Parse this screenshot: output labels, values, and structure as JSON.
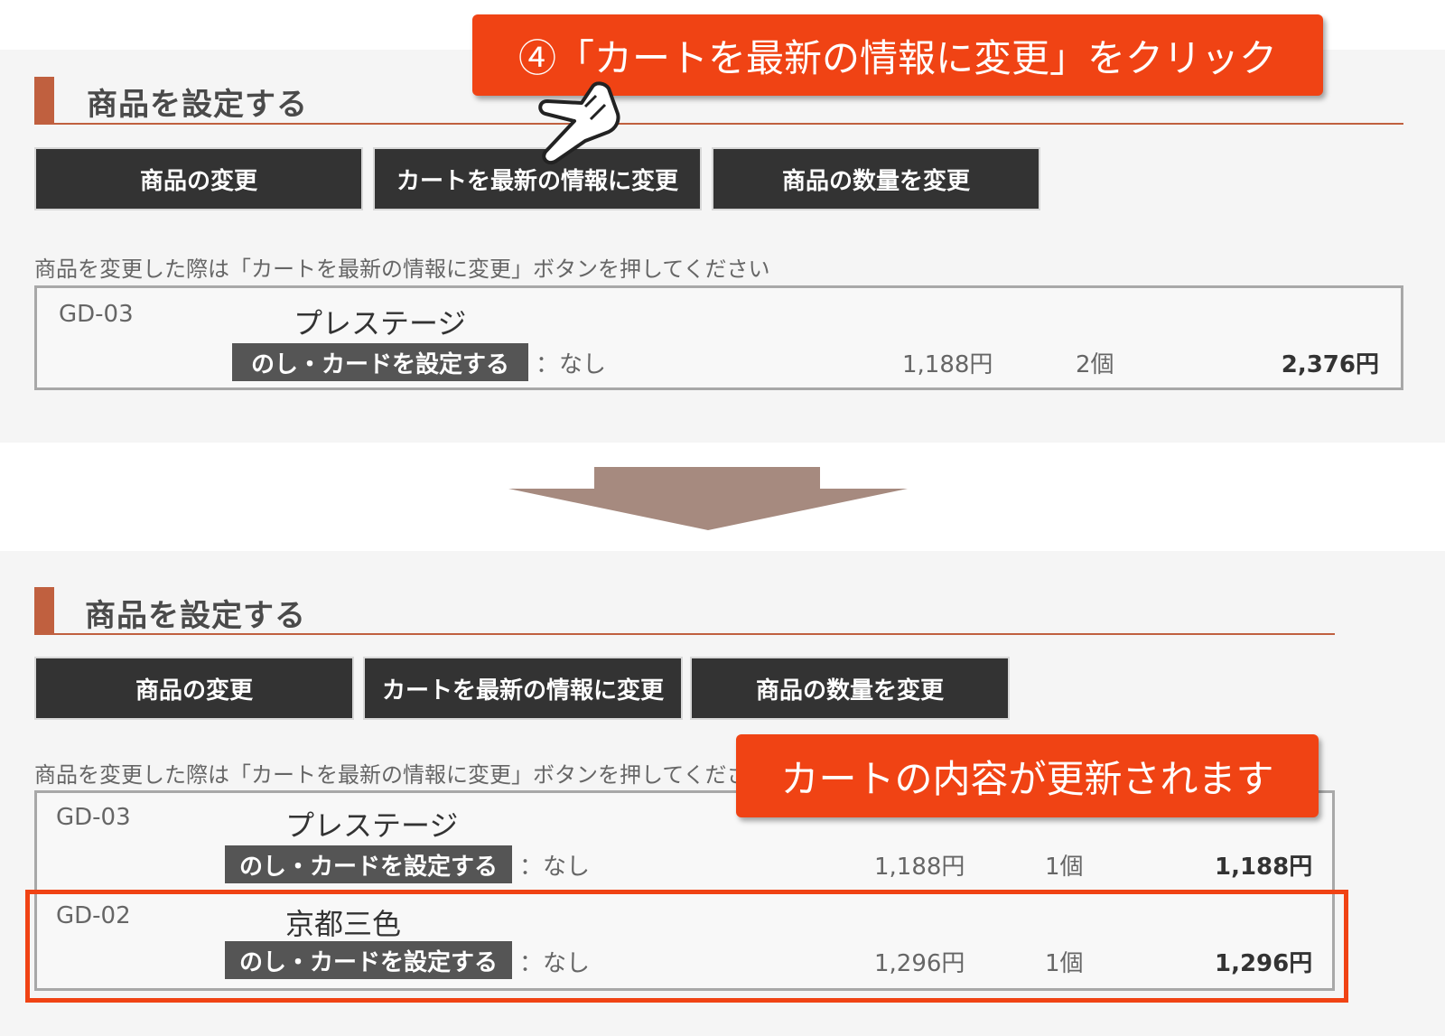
{
  "before": {
    "heading": "商品を設定する",
    "buttons": [
      "商品の変更",
      "カートを最新の情報に変更",
      "商品の数量を変更"
    ],
    "note": "商品を変更した際は「カートを最新の情報に変更」ボタンを押してください",
    "items": [
      {
        "code": "GD-03",
        "name": "プレステージ",
        "tag": "のし・カードを設定する",
        "setting": "：なし",
        "price": "1,188円",
        "qty": "2個",
        "total": "2,376円"
      }
    ]
  },
  "after": {
    "heading": "商品を設定する",
    "buttons": [
      "商品の変更",
      "カートを最新の情報に変更",
      "商品の数量を変更"
    ],
    "note": "商品を変更した際は「カートを最新の情報に変更」ボタンを押してください",
    "items": [
      {
        "code": "GD-03",
        "name": "プレステージ",
        "tag": "のし・カードを設定する",
        "setting": "：なし",
        "price": "1,188円",
        "qty": "1個",
        "total": "1,188円"
      },
      {
        "code": "GD-02",
        "name": "京都三色",
        "tag": "のし・カードを設定する",
        "setting": "：なし",
        "price": "1,296円",
        "qty": "1個",
        "total": "1,296円"
      }
    ]
  },
  "callouts": {
    "step": "④「カートを最新の情報に変更」をクリック",
    "result": "カートの内容が更新されます"
  },
  "icons": {
    "pointer": "hand-pointer-icon",
    "arrow": "arrow-down-icon"
  },
  "colors": {
    "accent": "#c0603f",
    "callout": "#f04314",
    "button": "#333333",
    "arrow": "#a68a7f"
  }
}
